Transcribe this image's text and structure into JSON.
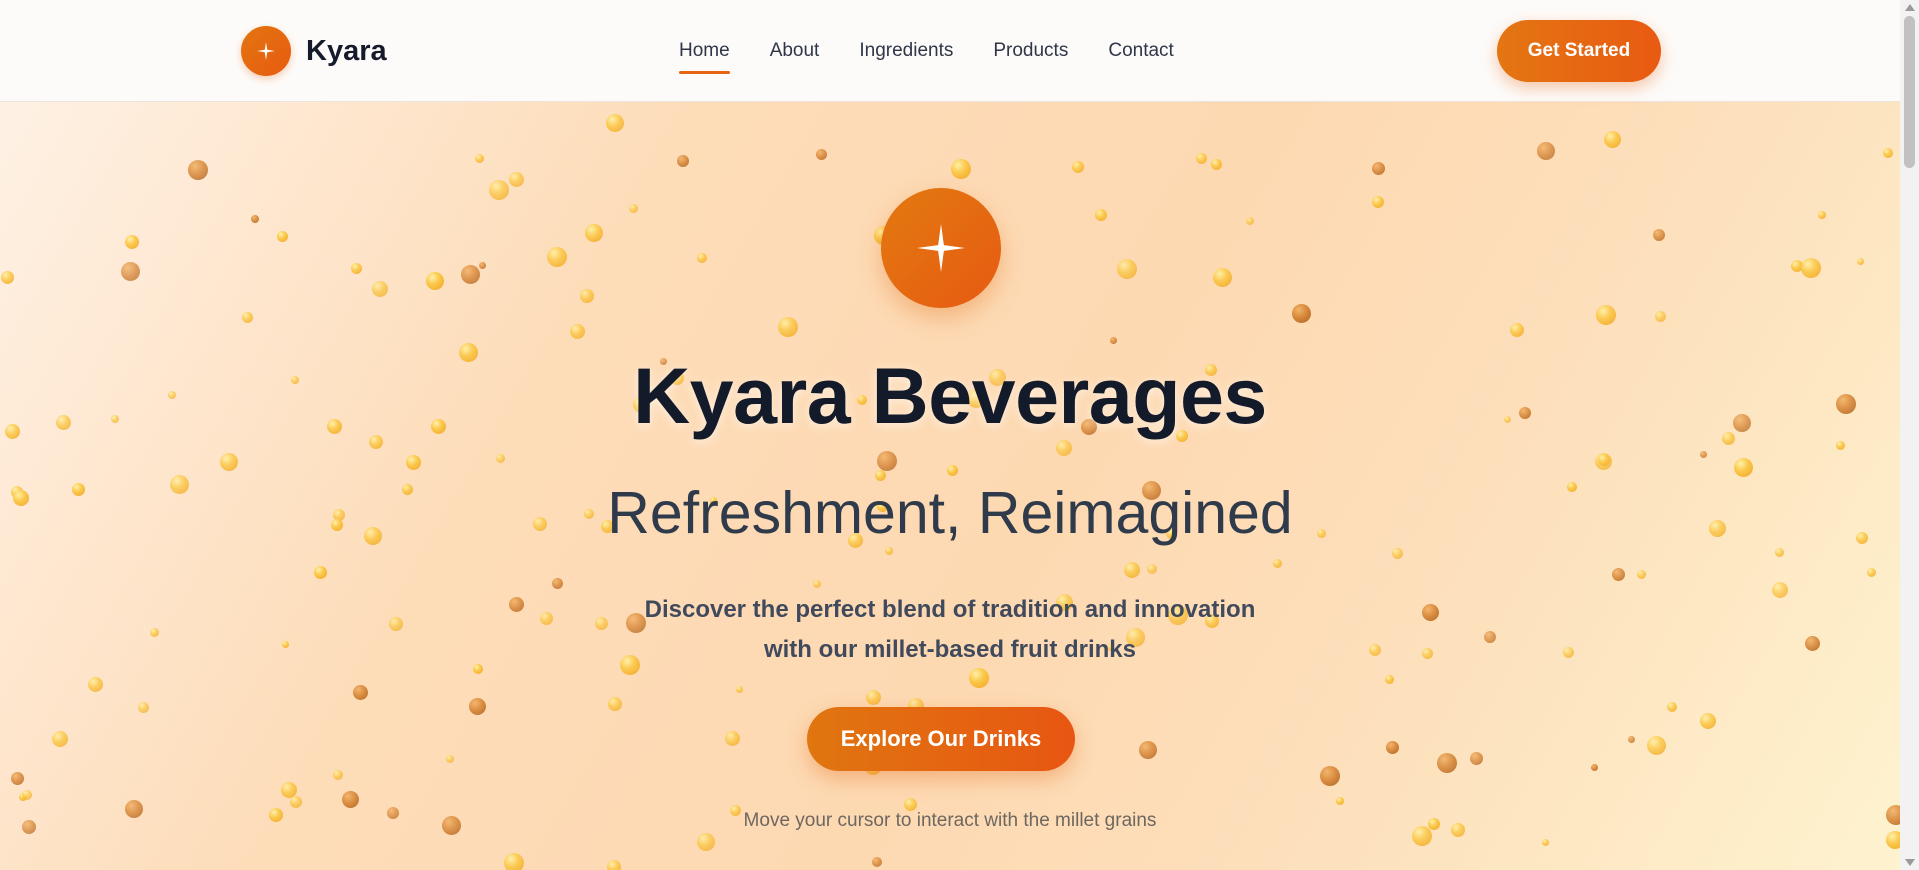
{
  "brand": {
    "name": "Kyara",
    "logo_icon": "sparkle-icon"
  },
  "nav": {
    "items": [
      {
        "label": "Home",
        "active": true
      },
      {
        "label": "About",
        "active": false
      },
      {
        "label": "Ingredients",
        "active": false
      },
      {
        "label": "Products",
        "active": false
      },
      {
        "label": "Contact",
        "active": false
      }
    ]
  },
  "header": {
    "cta_label": "Get Started"
  },
  "hero": {
    "icon": "sparkle-icon",
    "title": "Kyara Beverages",
    "subtitle": "Refreshment, Reimagined",
    "description_line1": "Discover the perfect blend of tradition and innovation",
    "description_line2": "with our millet-based fruit drinks",
    "button_label": "Explore Our Drinks",
    "hint": "Move your cursor to interact with the millet grains"
  },
  "colors": {
    "accent": "#e66414",
    "accent_gradient_start": "#e27610",
    "accent_gradient_end": "#e85a12",
    "title": "#131a2a",
    "text": "#404a5c",
    "grain_gold": "#f5b22e",
    "grain_brown": "#c47a30"
  }
}
